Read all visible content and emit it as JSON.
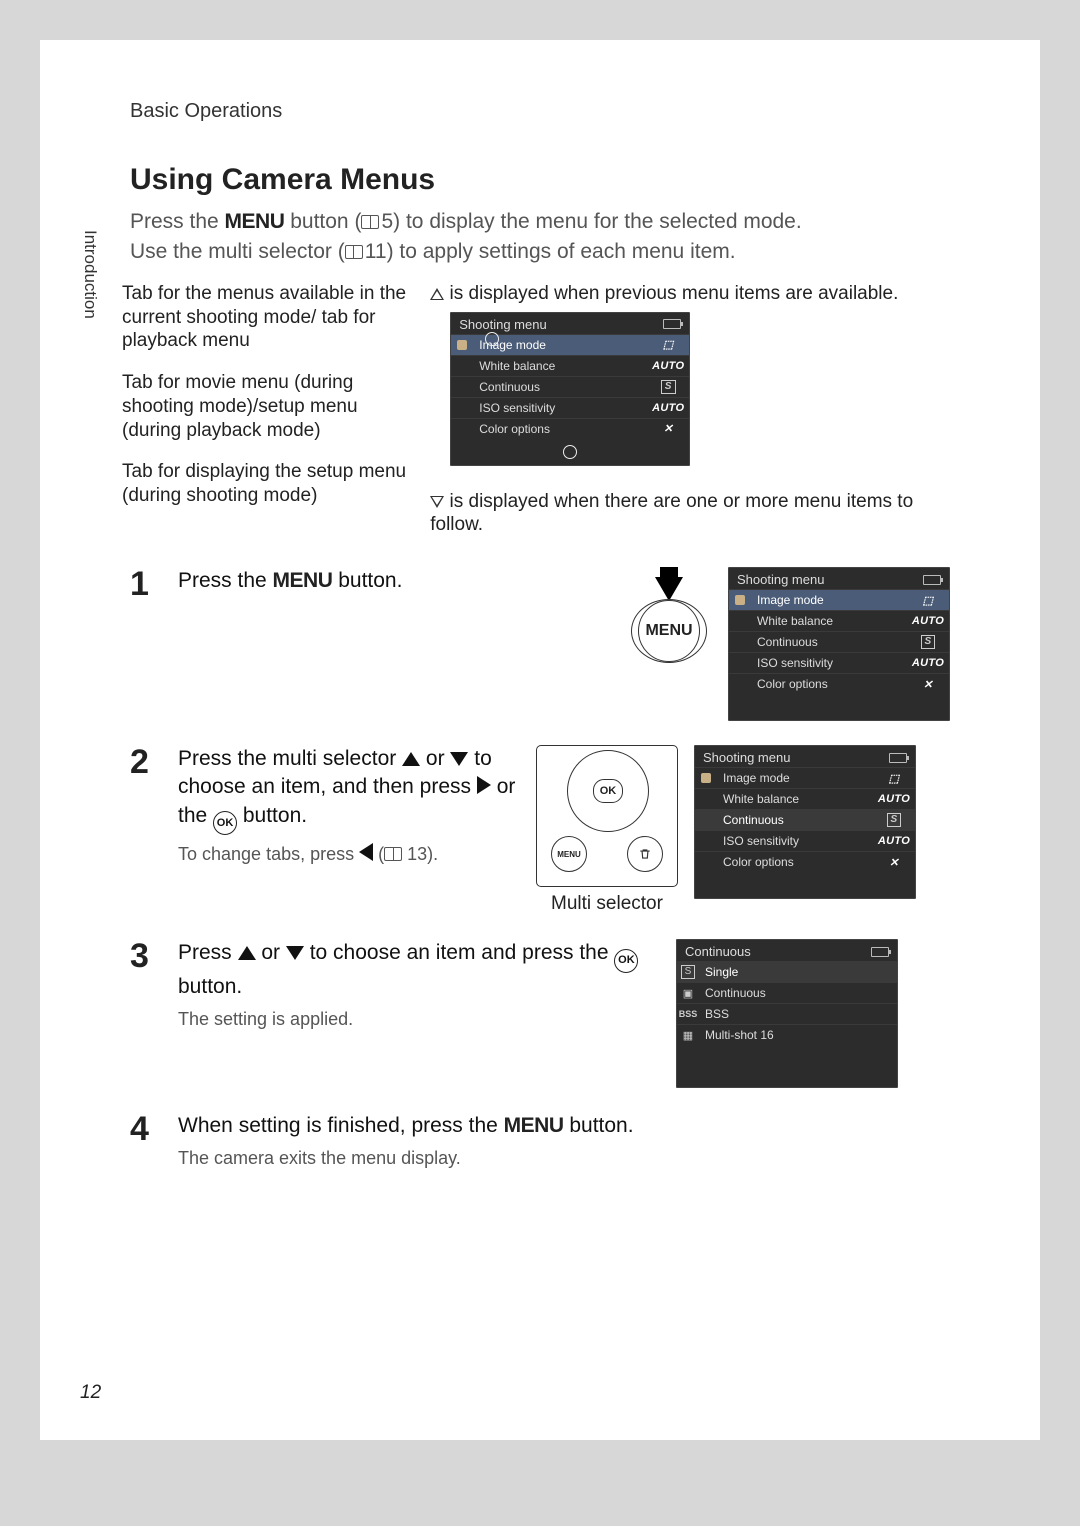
{
  "running_head": "Basic Operations",
  "side_tab": "Introduction",
  "page_number": "12",
  "h1": "Using Camera Menus",
  "intro": {
    "line1a": "Press the ",
    "menu_word": "MENU",
    "line1b": " button (",
    "ref1": "5",
    "line1c": ") to display the menu for the selected mode.",
    "line2a": "Use the multi selector (",
    "ref2": "11",
    "line2b": ") to apply settings of each menu item."
  },
  "diagram": {
    "left": {
      "c1": "Tab for the menus available in the current shooting mode/ tab for playback menu",
      "c2": "Tab for movie menu (during shooting mode)/setup menu (during playback mode)",
      "c3": "Tab for displaying the setup menu (during shooting mode)"
    },
    "right_top": " is displayed when previous menu items are available.",
    "right_bot": " is displayed when there are one or more menu items to follow."
  },
  "lcd_main": {
    "title": "Shooting menu",
    "rows": [
      {
        "label": "Image mode",
        "val": "⬚",
        "sel": true
      },
      {
        "label": "White balance",
        "val": "AUTO"
      },
      {
        "label": "Continuous",
        "val": "S"
      },
      {
        "label": "ISO sensitivity",
        "val": "AUTO"
      },
      {
        "label": "Color options",
        "val": "✕"
      }
    ]
  },
  "steps": {
    "s1": {
      "num": "1",
      "title_a": "Press the ",
      "title_b": " button."
    },
    "s2": {
      "num": "2",
      "title_a": "Press the multi selector ",
      "title_b": " or ",
      "title_c": " to choose an item, and then press ",
      "title_d": " or the ",
      "title_e": " button.",
      "note_a": "To change tabs, press ",
      "note_b": " (",
      "note_ref": "13",
      "note_c": ").",
      "selector_caption": "Multi selector"
    },
    "s3": {
      "num": "3",
      "title_a": "Press ",
      "title_b": " or ",
      "title_c": " to choose an item and press the ",
      "title_d": " button.",
      "note": "The setting is applied."
    },
    "s4": {
      "num": "4",
      "title_a": "When setting is finished, press the ",
      "title_b": " button.",
      "note": "The camera exits the menu display."
    }
  },
  "lcd_step2": {
    "title": "Shooting menu",
    "rows": [
      {
        "label": "Image mode",
        "val": "⬚"
      },
      {
        "label": "White balance",
        "val": "AUTO"
      },
      {
        "label": "Continuous",
        "val": "S",
        "sel": true
      },
      {
        "label": "ISO sensitivity",
        "val": "AUTO"
      },
      {
        "label": "Color options",
        "val": "✕"
      }
    ]
  },
  "lcd_step3": {
    "title": "Continuous",
    "rows": [
      {
        "icon": "S",
        "label": "Single",
        "sel": true
      },
      {
        "icon": "▣",
        "label": "Continuous"
      },
      {
        "icon": "BSS",
        "label": "BSS"
      },
      {
        "icon": "▦",
        "label": "Multi-shot 16"
      }
    ]
  },
  "menu_btn_label": "MENU",
  "ok_label": "OK"
}
